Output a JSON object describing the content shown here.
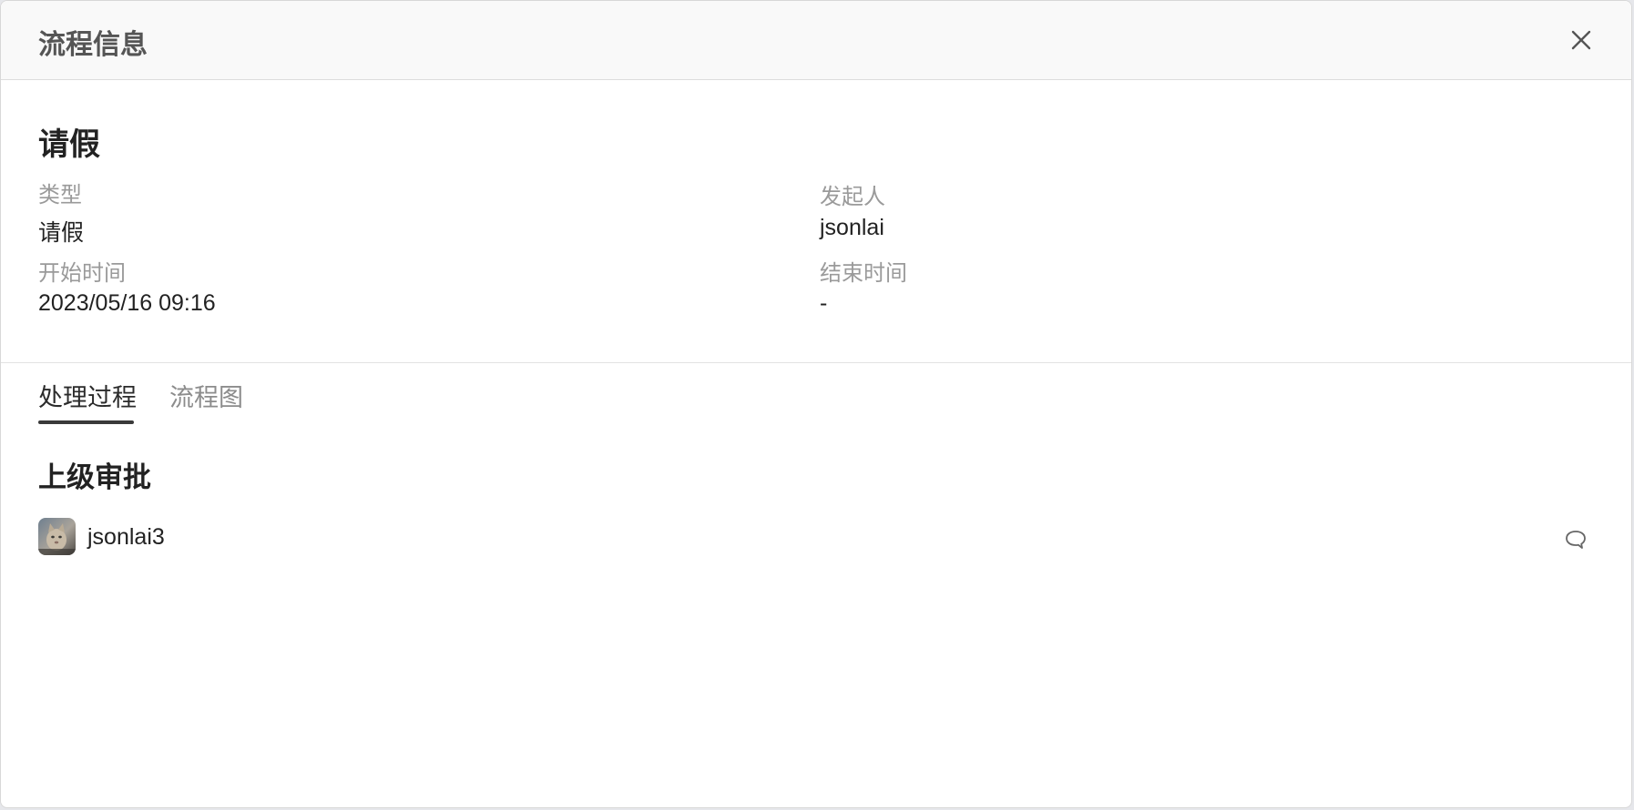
{
  "dialog": {
    "title": "流程信息",
    "close_icon": "close-icon"
  },
  "info": {
    "title": "请假",
    "type_label": "类型",
    "type_value": "请假",
    "initiator_label": "发起人",
    "initiator_value": "jsonlai",
    "start_time_label": "开始时间",
    "start_time_value": "2023/05/16 09:16",
    "end_time_label": "结束时间",
    "end_time_value": "-"
  },
  "tabs": [
    {
      "label": "处理过程",
      "active": true
    },
    {
      "label": "流程图",
      "active": false
    }
  ],
  "process": {
    "step_title": "上级审批",
    "approver": {
      "name": "jsonlai3",
      "avatar_icon": "avatar-cat-photo",
      "action_icon": "comment-icon"
    }
  },
  "colors": {
    "active_tab_underline": "#3a3a3a",
    "label_gray": "#9a9a9a",
    "header_bg": "#f9f9f9"
  }
}
